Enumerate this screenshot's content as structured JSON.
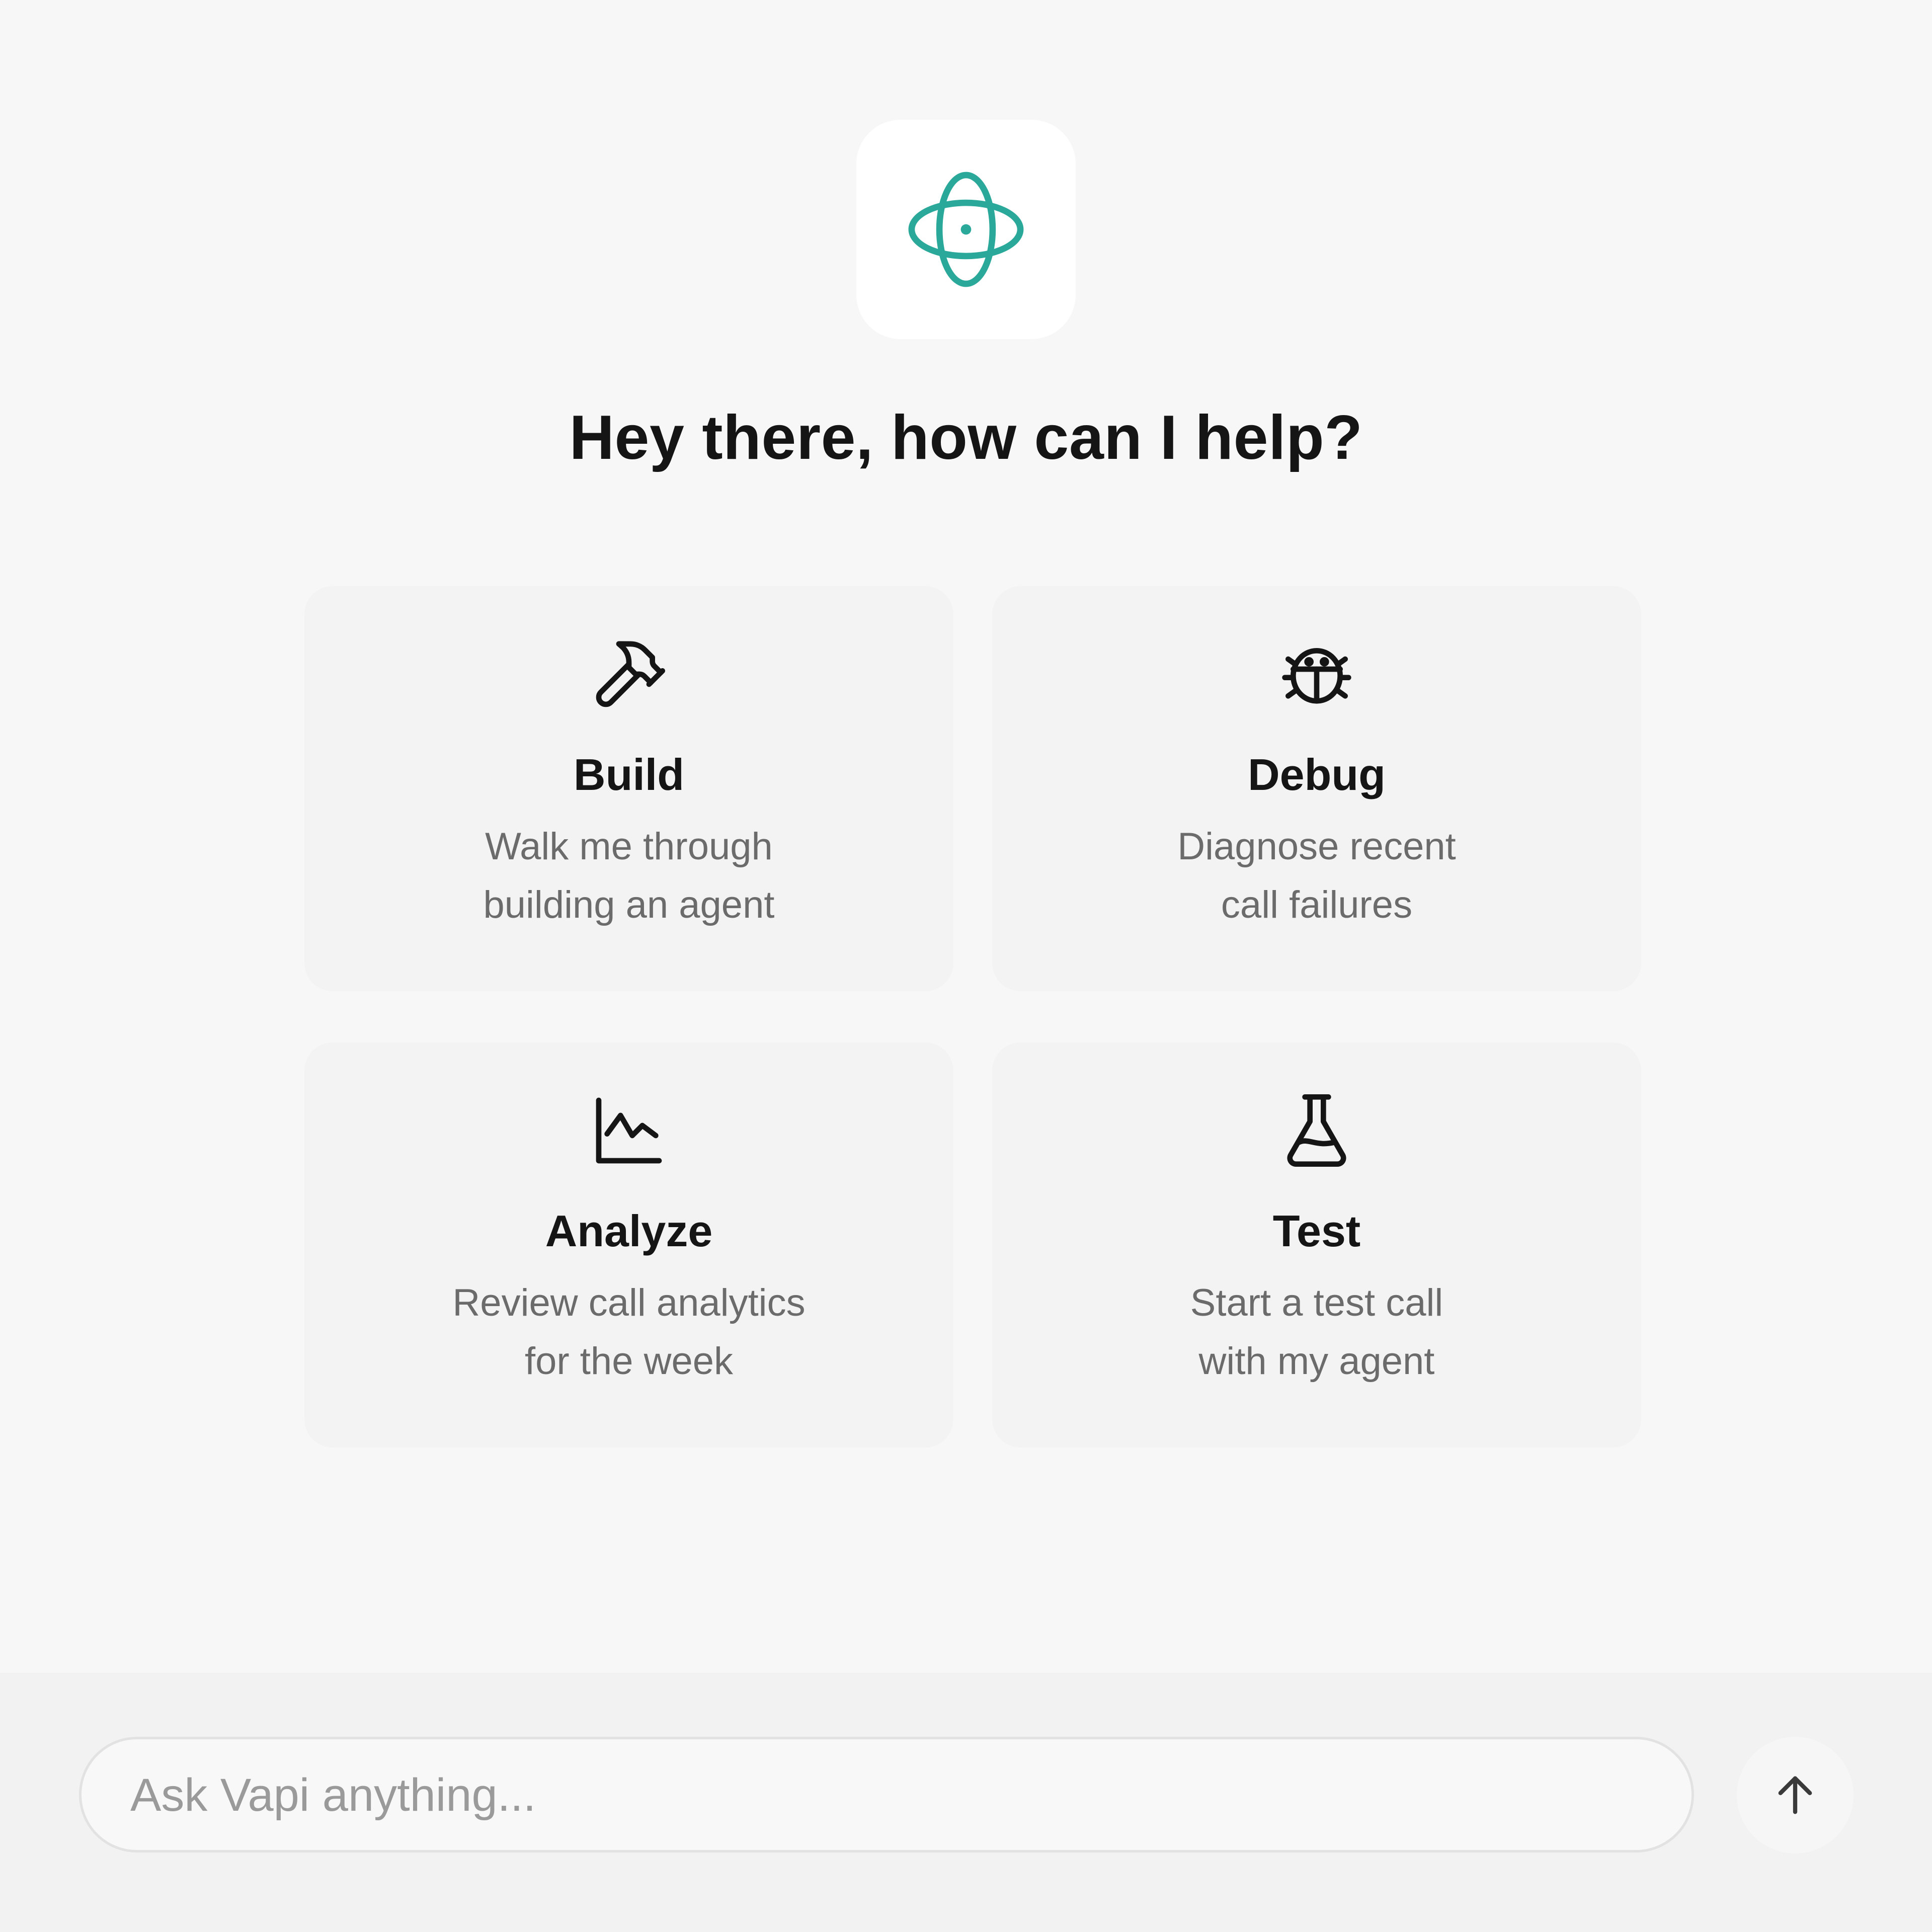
{
  "brand": {
    "logo_icon": "orbit-icon",
    "accent_color": "#2aa89a"
  },
  "headline": "Hey there, how can I help?",
  "cards": [
    {
      "id": "build",
      "icon": "hammer-icon",
      "title": "Build",
      "desc_line1": "Walk me through",
      "desc_line2": "building an agent"
    },
    {
      "id": "debug",
      "icon": "bug-icon",
      "title": "Debug",
      "desc_line1": "Diagnose recent",
      "desc_line2": "call failures"
    },
    {
      "id": "analyze",
      "icon": "line-chart-icon",
      "title": "Analyze",
      "desc_line1": "Review call analytics",
      "desc_line2": "for the week"
    },
    {
      "id": "test",
      "icon": "flask-icon",
      "title": "Test",
      "desc_line1": "Start a test call",
      "desc_line2": "with my agent"
    }
  ],
  "composer": {
    "placeholder": "Ask Vapi anything...",
    "value": "",
    "send_icon": "arrow-up-icon"
  }
}
